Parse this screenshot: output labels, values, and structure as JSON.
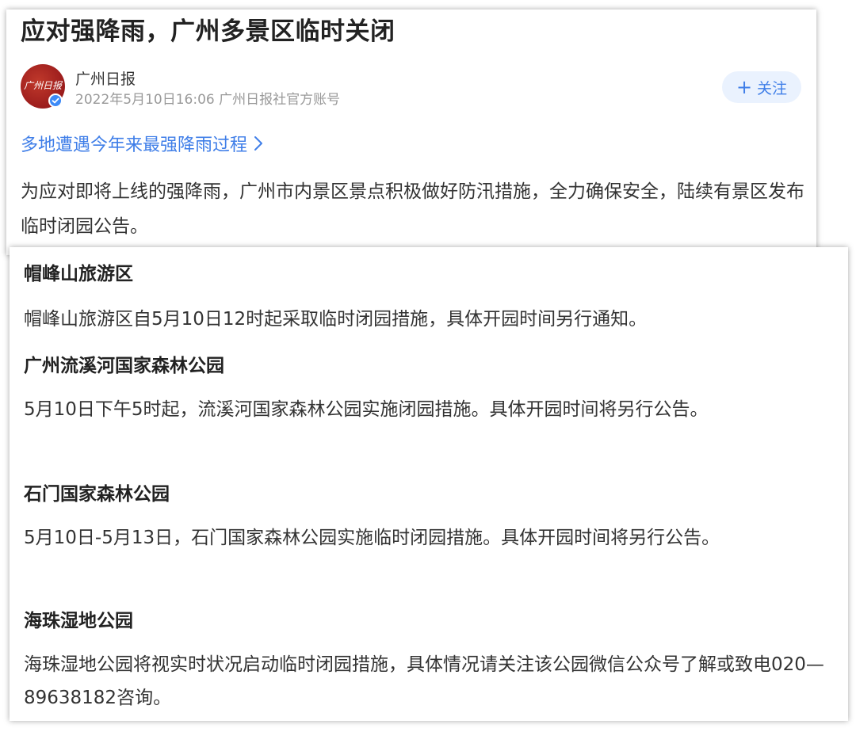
{
  "article": {
    "title": "应对强降雨，广州多景区临时关闭",
    "author": {
      "name": "广州日报",
      "meta": "2022年5月10日16:06 广州日报社官方账号",
      "avatar_text": "广州日报"
    },
    "follow_label": "关注",
    "topic_link": "多地遭遇今年来最强降雨过程",
    "intro": "为应对即将上线的强降雨，广州市内景区景点积极做好防汛措施，全力确保安全，陆续有景区发布临时闭园公告。",
    "sections": [
      {
        "heading": "帽峰山旅游区",
        "text": "帽峰山旅游区自5月10日12时起采取临时闭园措施，具体开园时间另行通知。"
      },
      {
        "heading": "广州流溪河国家森林公园",
        "text": "5月10日下午5时起，流溪河国家森林公园实施闭园措施。具体开园时间将另行公告。"
      },
      {
        "heading": "石门国家森林公园",
        "text": "5月10日-5月13日，石门国家森林公园实施临时闭园措施。具体开园时间将另行公告。"
      },
      {
        "heading": "海珠湿地公园",
        "text": "海珠湿地公园将视实时状况启动临时闭园措施，具体情况请关注该公园微信公众号了解或致电020—89638182咨询。"
      }
    ]
  },
  "colors": {
    "accent": "#3f7ee8",
    "follow_bg": "#eaf2fe",
    "text": "#333333",
    "meta": "#999999",
    "avatar": "#9b1c1c"
  },
  "icons": [
    "verified-badge-icon",
    "plus-icon",
    "chevron-right-icon"
  ]
}
